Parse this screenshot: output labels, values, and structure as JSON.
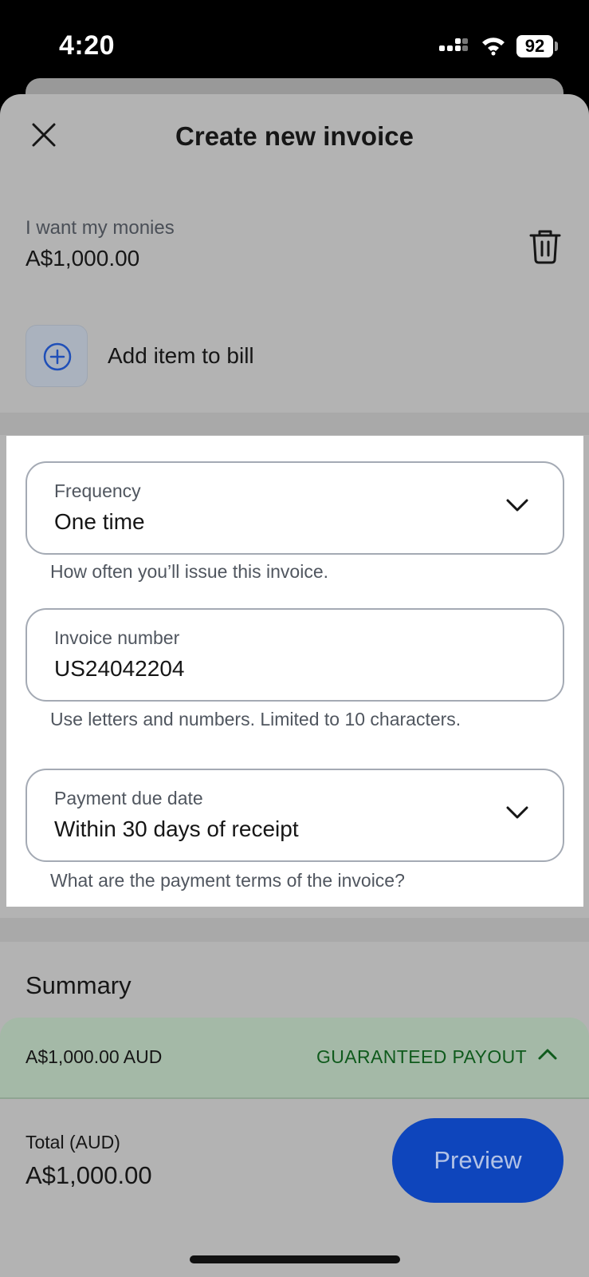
{
  "status_bar": {
    "time": "4:20",
    "battery": "92"
  },
  "header": {
    "title": "Create new invoice",
    "close_icon": "close-icon"
  },
  "bill_item": {
    "name": "I want my monies",
    "amount": "A$1,000.00",
    "delete_icon": "trash-icon"
  },
  "add_item": {
    "label": "Add item to bill",
    "icon": "plus-circle-icon"
  },
  "form": {
    "frequency": {
      "label": "Frequency",
      "value": "One time",
      "helper": "How often you’ll issue this invoice."
    },
    "invoice_number": {
      "label": "Invoice number",
      "value": "US24042204",
      "helper": "Use letters and numbers. Limited to 10 characters."
    },
    "due_date": {
      "label": "Payment due date",
      "value": "Within 30 days of receipt",
      "helper": "What are the payment terms of the invoice?"
    }
  },
  "summary": {
    "title": "Summary",
    "amount": "A$1,000.00 AUD",
    "badge": "GUARANTEED PAYOUT",
    "total_label": "Total (AUD)",
    "total_value": "A$1,000.00"
  },
  "actions": {
    "preview_label": "Preview"
  },
  "colors": {
    "accent": "#0e45bc",
    "payout_green": "#0f5a1c",
    "overlay": "#b3b3b3"
  }
}
